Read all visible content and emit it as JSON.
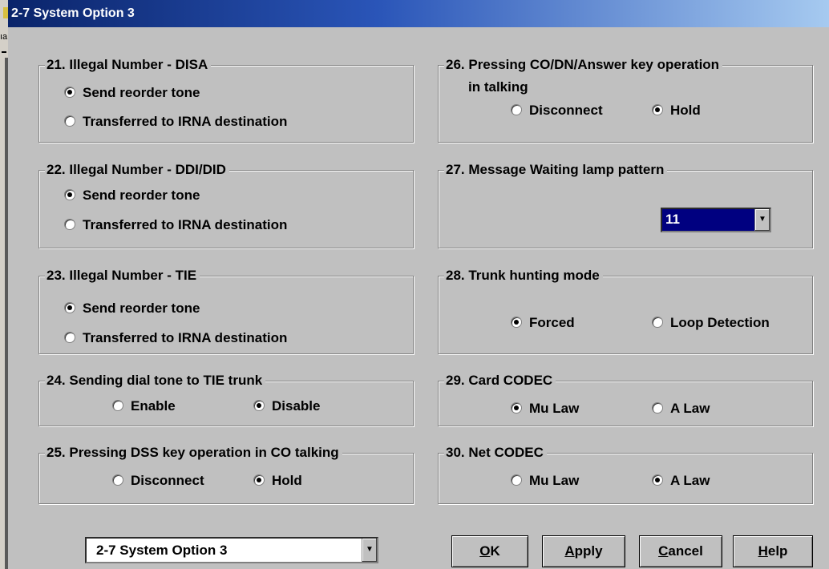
{
  "window": {
    "title": "2-7 System Option 3",
    "edge_fragment": "ıa"
  },
  "groups": {
    "g21": {
      "title": "21. Illegal Number - DISA",
      "options": [
        "Send reorder tone",
        "Transferred to IRNA destination"
      ],
      "selected": 0
    },
    "g22": {
      "title": "22. Illegal Number - DDI/DID",
      "options": [
        "Send reorder tone",
        "Transferred to IRNA destination"
      ],
      "selected": 0
    },
    "g23": {
      "title": "23. Illegal Number - TIE",
      "options": [
        "Send reorder tone",
        "Transferred to IRNA destination"
      ],
      "selected": 0
    },
    "g24": {
      "title": "24. Sending dial tone to TIE trunk",
      "options": [
        "Enable",
        "Disable"
      ],
      "selected": 1
    },
    "g25": {
      "title": "25. Pressing DSS key operation in CO talking",
      "options": [
        "Disconnect",
        "Hold"
      ],
      "selected": 1
    },
    "g26": {
      "title_line1": "26. Pressing CO/DN/Answer key operation",
      "title_line2": "in talking",
      "options": [
        "Disconnect",
        "Hold"
      ],
      "selected": 1
    },
    "g27": {
      "title": "27. Message Waiting lamp pattern",
      "value": "11"
    },
    "g28": {
      "title": "28. Trunk hunting mode",
      "options": [
        "Forced",
        "Loop Detection"
      ],
      "selected": 0
    },
    "g29": {
      "title": "29. Card CODEC",
      "options": [
        "Mu Law",
        "A Law"
      ],
      "selected": 0
    },
    "g30": {
      "title": "30. Net CODEC",
      "options": [
        "Mu Law",
        "A Law"
      ],
      "selected": 1
    }
  },
  "footer": {
    "page_select_value": "2-7 System Option 3",
    "ok": {
      "hot": "O",
      "rest": "K"
    },
    "apply": {
      "hot": "A",
      "rest": "pply"
    },
    "cancel": {
      "hot": "C",
      "rest": "ancel"
    },
    "help": {
      "hot": "H",
      "rest": "elp"
    }
  }
}
